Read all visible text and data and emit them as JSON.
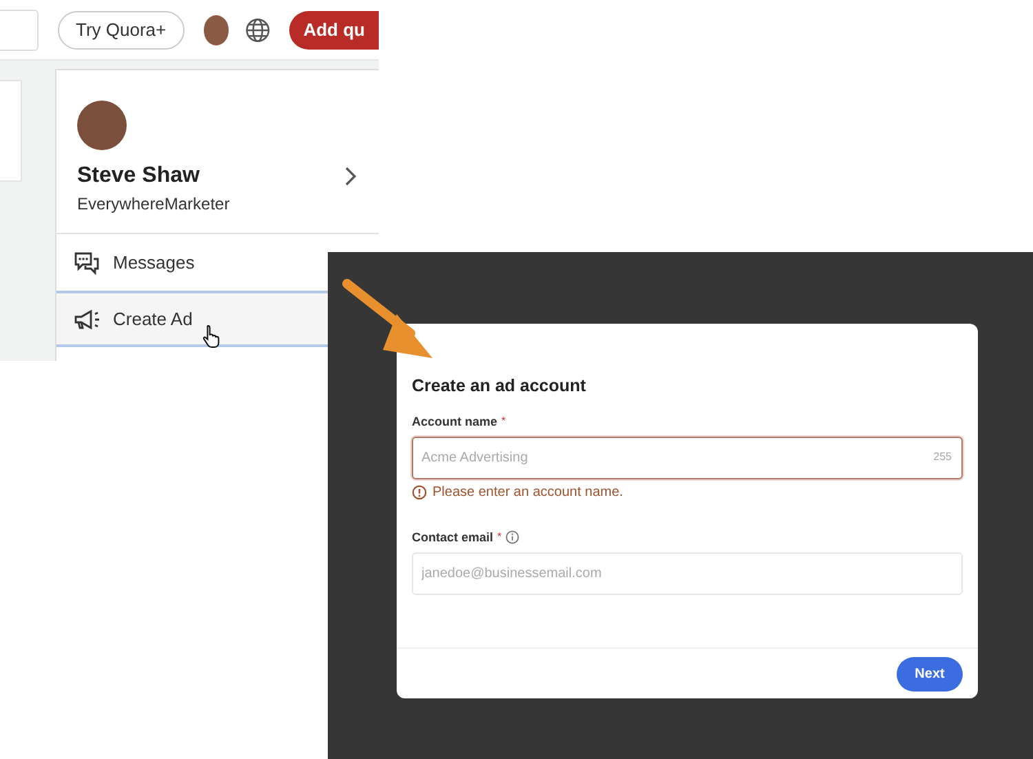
{
  "header": {
    "try_button": "Try Quora+",
    "add_button": "Add qu"
  },
  "profile": {
    "name": "Steve Shaw",
    "username": "EverywhereMarketer"
  },
  "menu": [
    {
      "label": "Messages",
      "kind": "messages",
      "selected": false
    },
    {
      "label": "Create Ad",
      "kind": "ad",
      "selected": true
    }
  ],
  "modal": {
    "title": "Create an ad account",
    "fields": [
      {
        "label": "Account name",
        "required_mark": "*",
        "placeholder": "Acme Advertising",
        "counter": "255",
        "error": "Please enter an account name.",
        "info": false
      },
      {
        "label": "Contact email",
        "required_mark": "*",
        "placeholder": "janedoe@businessemail.com",
        "info": true
      }
    ],
    "next_button": "Next"
  }
}
